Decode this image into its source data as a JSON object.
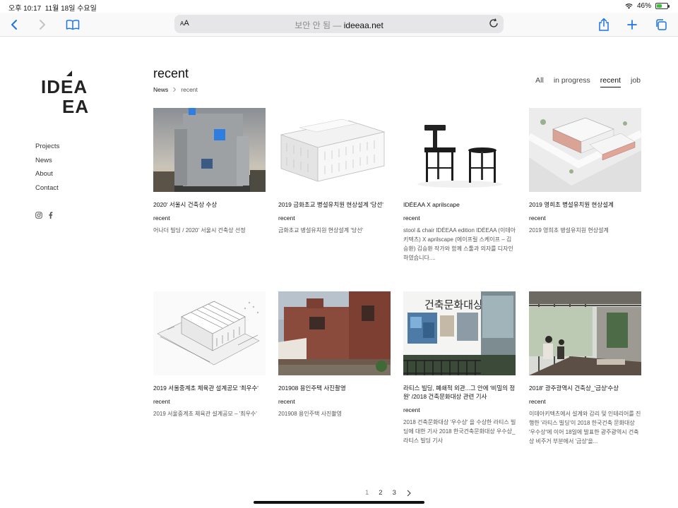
{
  "status": {
    "time": "오후 10:17",
    "date": "11월 18일 수요일",
    "battery": "46%",
    "battery_level": 0.46
  },
  "browser": {
    "aa_small": "A",
    "aa_big": "A",
    "insecure": "보안 안 됨",
    "separator": "—",
    "domain": "ideeaa.net"
  },
  "logo": {
    "line1": "IDEA",
    "line2": "EA"
  },
  "sidebar": {
    "items": [
      {
        "label": "Projects"
      },
      {
        "label": "News"
      },
      {
        "label": "About"
      },
      {
        "label": "Contact"
      }
    ]
  },
  "header": {
    "title": "recent",
    "breadcrumb": {
      "root": "News",
      "current": "recent"
    }
  },
  "filters": [
    {
      "label": "All"
    },
    {
      "label": "in progress"
    },
    {
      "label": "recent",
      "active": true
    },
    {
      "label": "job"
    }
  ],
  "posts": [
    {
      "title": "2020' 서울시 건축상 수상",
      "category": "recent",
      "desc": "어나더 빌딩 / 2020' 서울시 건축상 선정"
    },
    {
      "title": "2019 금화초교 병설유치원 현상설계 '당선'",
      "category": "recent",
      "desc": "금화초교 병설유치원 현상설계 '당선'"
    },
    {
      "title": "IDÉEAA X aprilscape",
      "category": "recent",
      "desc": "stool & chair IDÉEAA edition IDÉEAA (이데아키텍츠) X aprilscape (에이프릴 스케이프 – 김승환) 김승환 작가와 함께 스툴과 의자를 디자인 하였습니다...."
    },
    {
      "title": "2019 영희초 병설유치원 현상설계",
      "category": "recent",
      "desc": "2019 영희초 병설유치원 현상설계"
    },
    {
      "title": "2019 서울중계초 체육관 설계공모 '최우수'",
      "category": "recent",
      "desc": "2019 서울중계초 체육관 설계공모 – '최우수'"
    },
    {
      "title": "201908 용인주택 사진촬영",
      "category": "recent",
      "desc": "201908 용인주택 사진촬영"
    },
    {
      "title": "라티스 빌딩, 폐쇄적 외관...그 안에 '비밀의 정원' /2018 건축문화대상 관련 기사",
      "category": "recent",
      "desc": "2018 건축문화대상 '우수상' 을 수상한 라티스 빌딩에 대한 기사 2018 한국건축문화대상 우수상_라티스 빌딩 기사"
    },
    {
      "title": "2018' 광주광역시 건축상_'금상'수상",
      "category": "recent",
      "desc": "이데아키텍츠에서 설계와 감리 및 인테리어를 진행한 '라티스 빌딩'이 2018 한국건축 문화대상 '우수상'에 이어 18일에 발표한 광주광역시 건축상 비주거 부분에서 '금상'을..."
    }
  ],
  "pagination": {
    "pages": [
      "1",
      "2",
      "3"
    ],
    "current": "1"
  },
  "exhibit_sign": "건축문화대상展",
  "colors": {
    "accent_blue": "#1a73e8",
    "text": "#222222",
    "battery_green": "#3cc13b"
  }
}
